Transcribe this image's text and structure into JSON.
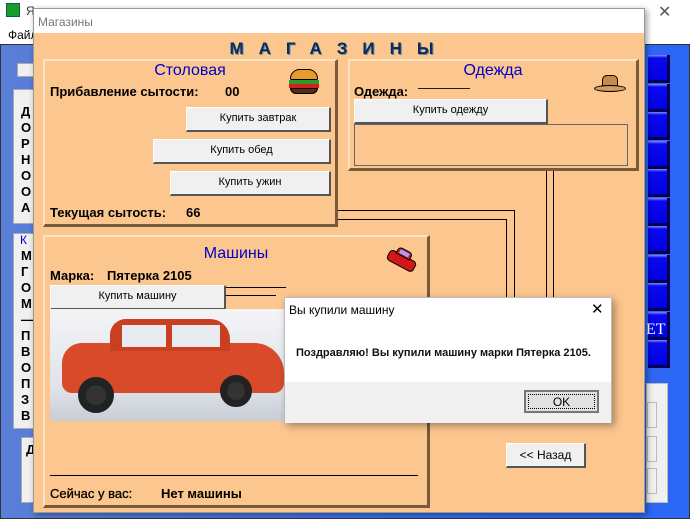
{
  "bg_window": {
    "title": "Я",
    "menu": [
      "Файл"
    ],
    "left_letters_1": [
      "Д",
      "О",
      "Р",
      "Н",
      "О",
      "О",
      "А"
    ],
    "left_group2_label": "К",
    "left_letters_2": [
      "М",
      "Г",
      "О",
      "М",
      "—",
      "П",
      "В",
      "О",
      "П",
      "З",
      "В"
    ],
    "left_bottom_letter": "Д",
    "right_button_text": "ЕТ",
    "close_icon": "close-icon"
  },
  "window": {
    "title": "Магазины",
    "heading": "МАГАЗИНЫ"
  },
  "canteen": {
    "title": "Столовая",
    "satiety_gain_label": "Прибавление сытости:",
    "satiety_gain_value": "00",
    "breakfast_button": "Купить завтрак",
    "lunch_button": "Купить обед",
    "dinner_button": "Купить ужин",
    "current_satiety_label": "Текущая сытость:",
    "current_satiety_value": "66",
    "icon": "burger-icon"
  },
  "clothes": {
    "title": "Одежда",
    "clothes_label": "Одежда:",
    "clothes_value": "————",
    "buy_button": "Купить одежду",
    "icon": "hat-icon"
  },
  "cars": {
    "title": "Машины",
    "brand_label": "Марка:",
    "brand_value": "Пятерка 2105",
    "buy_button": "Купить машину",
    "have_label": "Сейчас у вас:",
    "have_value": "Нет машины",
    "icon": "car-icon"
  },
  "back_button": "<< Назад",
  "dialog": {
    "title": "Вы купили машину",
    "message": "Поздравляю! Вы купили машину марки Пятерка 2105.",
    "ok_button": "OK"
  },
  "colors": {
    "panel": "#fcc78e",
    "title_blue": "#0000c8",
    "bg_blue": "#3a6ff0"
  }
}
